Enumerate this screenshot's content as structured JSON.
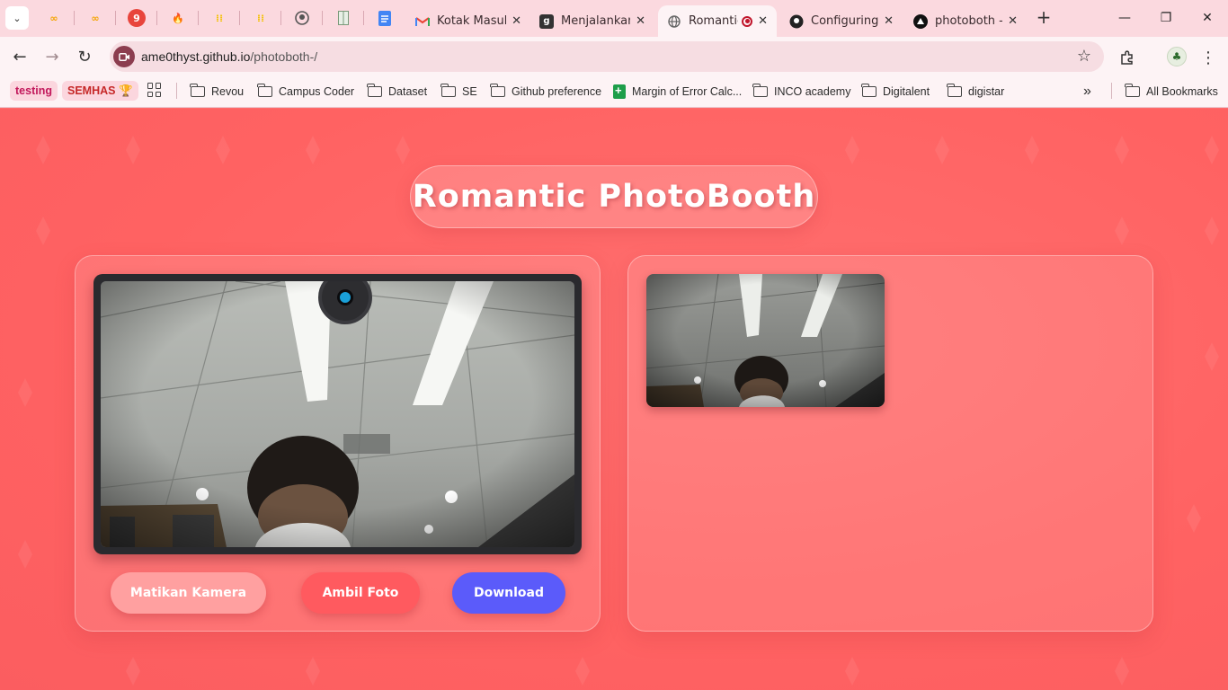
{
  "browser": {
    "pinned_tabs": [
      {
        "icon": "infinity-icon",
        "color": "#f4a400"
      },
      {
        "icon": "infinity-icon",
        "color": "#f4a400"
      },
      {
        "icon": "number-nine-icon",
        "label": "9",
        "color": "#e8453c"
      },
      {
        "icon": "fire-icon",
        "color": "#f4a400"
      },
      {
        "icon": "dots-grid-icon",
        "color": "#f4c20d"
      },
      {
        "icon": "dots-grid-icon",
        "color": "#f4c20d"
      },
      {
        "icon": "github-icon",
        "color": "#333333"
      },
      {
        "icon": "spreadsheet-icon",
        "color": "#5a8f5a"
      },
      {
        "icon": "docs-icon",
        "color": "#4285f4"
      }
    ],
    "tabs": [
      {
        "title": "Kotak Masuk",
        "icon": "gmail-icon"
      },
      {
        "title": "Menjalankan",
        "icon": "g-icon"
      },
      {
        "title": "Romantic",
        "icon": "globe-icon",
        "active": true
      },
      {
        "title": "Configuring",
        "icon": "github-icon"
      },
      {
        "title": "photoboth -",
        "icon": "triangle-icon"
      }
    ],
    "new_tab_label": "+",
    "url_host": "ame0thyst.github.io",
    "url_path": "/photoboth-/",
    "bookmarks": [
      {
        "label": "testing",
        "type": "chip",
        "color": "#c2185b",
        "bg": "#fbd6de"
      },
      {
        "label": "SEMHAS 🏆",
        "type": "chip",
        "color": "#c62828",
        "bg": "#fbd6de"
      },
      {
        "label": "Revou",
        "type": "folder"
      },
      {
        "label": "Campus Coder",
        "type": "folder"
      },
      {
        "label": "Dataset",
        "type": "folder"
      },
      {
        "label": "SE",
        "type": "folder"
      },
      {
        "label": "Github preference",
        "type": "folder"
      },
      {
        "label": "Margin of Error Calc...",
        "type": "sheet"
      },
      {
        "label": "INCO academy",
        "type": "folder"
      },
      {
        "label": "Digitalent",
        "type": "folder"
      },
      {
        "label": "digistar",
        "type": "folder"
      }
    ],
    "more_bookmarks": "»",
    "all_bookmarks": "All Bookmarks"
  },
  "app": {
    "title": "Romantic PhotoBooth",
    "buttons": {
      "camera_off": "Matikan Kamera",
      "take_photo": "Ambil Foto",
      "download": "Download"
    },
    "colors": {
      "background": "#ff6b6b",
      "camera_off_button": "#ffa0a0",
      "take_photo_button": "#ff5a5f",
      "download_button": "#5b5bfa"
    }
  }
}
